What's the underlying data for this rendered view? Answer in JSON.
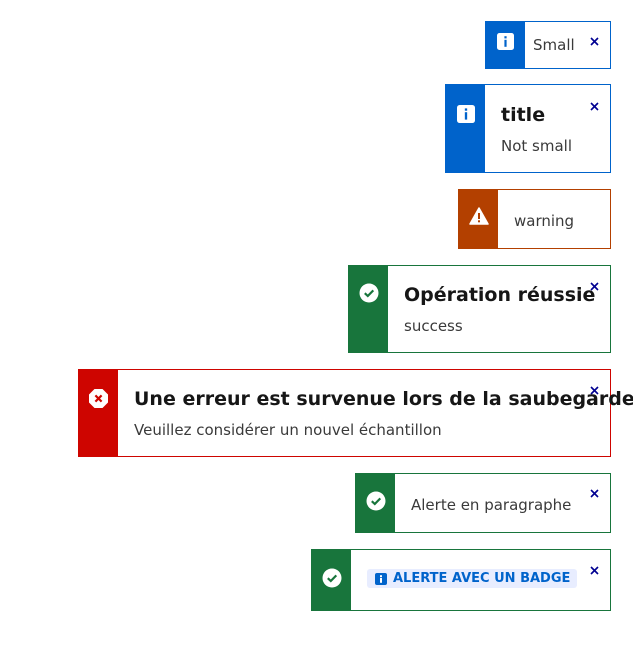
{
  "colors": {
    "info": "#0063cb",
    "warning": "#b34000",
    "success": "#18753c",
    "error": "#ce0500",
    "close": "#000091"
  },
  "alerts": [
    {
      "type": "info",
      "icon": "info-icon",
      "description": "Small"
    },
    {
      "type": "info",
      "icon": "info-icon",
      "title": "title",
      "description": "Not small"
    },
    {
      "type": "warning",
      "icon": "warning-icon",
      "description": "warning"
    },
    {
      "type": "success",
      "icon": "check-circle-icon",
      "title": "Opération réussie",
      "description": "success"
    },
    {
      "type": "error",
      "icon": "error-icon",
      "title": "Une erreur est survenue lors de la saubegarde",
      "description": "Veuillez considérer un nouvel échantillon"
    },
    {
      "type": "success",
      "icon": "check-circle-icon",
      "description": "Alerte en paragraphe"
    },
    {
      "type": "success",
      "icon": "check-circle-icon",
      "badge": {
        "icon": "info-icon",
        "label": "ALERTE AVEC UN BADGE"
      }
    }
  ],
  "close_label": "×"
}
